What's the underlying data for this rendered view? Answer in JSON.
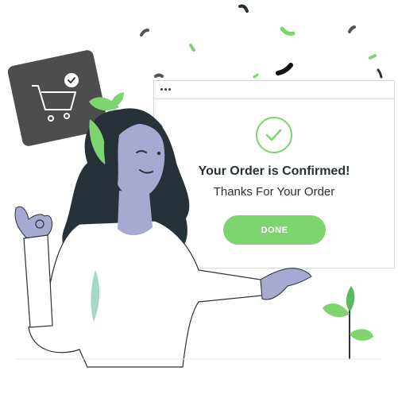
{
  "dialog": {
    "heading": "Your Order is Confirmed!",
    "message": "Thanks For Your Order",
    "done_label": "DONE"
  },
  "icons": {
    "cart": "shopping-cart-icon",
    "cart_check": "check-icon",
    "confirm": "checkmark-circle-icon"
  },
  "colors": {
    "accent": "#7ed56f",
    "text": "#263238",
    "card": "#4d4d4d",
    "hair": "#263238",
    "skin": "#a7a9d0"
  }
}
